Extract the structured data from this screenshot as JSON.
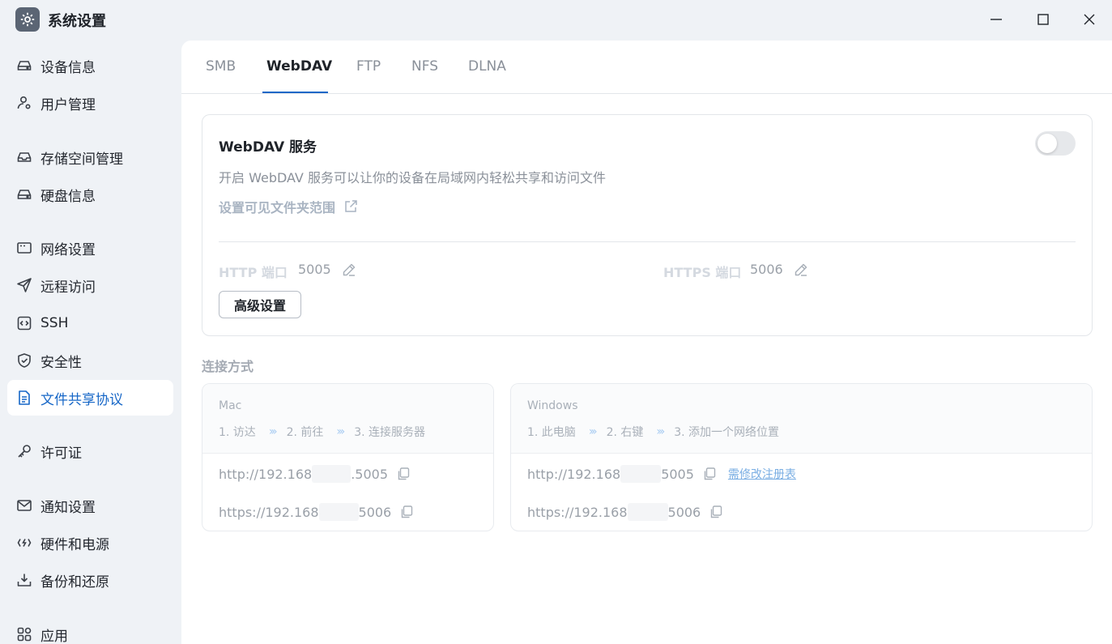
{
  "window": {
    "title": "系统设置",
    "controls": [
      "minimize",
      "maximize",
      "close"
    ]
  },
  "sidebar": {
    "items": [
      {
        "label": "设备信息",
        "icon": "drive-icon"
      },
      {
        "label": "用户管理",
        "icon": "user-gear-icon"
      },
      {
        "label": "存储空间管理",
        "icon": "storage-icon"
      },
      {
        "label": "硬盘信息",
        "icon": "disk-icon"
      },
      {
        "label": "网络设置",
        "icon": "network-icon"
      },
      {
        "label": "远程访问",
        "icon": "send-icon"
      },
      {
        "label": "SSH",
        "icon": "code-icon"
      },
      {
        "label": "安全性",
        "icon": "shield-icon"
      },
      {
        "label": "文件共享协议",
        "icon": "document-icon",
        "active": true
      },
      {
        "label": "许可证",
        "icon": "key-icon"
      },
      {
        "label": "通知设置",
        "icon": "mail-icon"
      },
      {
        "label": "硬件和电源",
        "icon": "power-icon"
      },
      {
        "label": "备份和还原",
        "icon": "download-tray-icon"
      },
      {
        "label": "应用",
        "icon": "grid-icon"
      }
    ]
  },
  "tabs": {
    "items": [
      "SMB",
      "WebDAV",
      "FTP",
      "NFS",
      "DLNA"
    ],
    "active": "WebDAV"
  },
  "service": {
    "title": "WebDAV 服务",
    "description": "开启 WebDAV 服务可以让你的设备在局域网内轻松共享和访问文件",
    "folder_link": "设置可见文件夹范围",
    "enabled": false,
    "http_label": "HTTP 端口",
    "http_port": "5005",
    "https_label": "HTTPS 端口",
    "https_port": "5006",
    "advanced_button": "高级设置"
  },
  "connection": {
    "title": "连接方式",
    "mac": {
      "os": "Mac",
      "steps": [
        "1. 访达",
        "2. 前往",
        "3. 连接服务器"
      ],
      "http_prefix": "http://192.168",
      "http_suffix": ".5005",
      "https_prefix": "https://192.168",
      "https_suffix": "5006"
    },
    "windows": {
      "os": "Windows",
      "steps": [
        "1. 此电脑",
        "2. 右键",
        "3. 添加一个网络位置"
      ],
      "http_prefix": "http://192.168",
      "http_suffix": "5005",
      "https_prefix": "https://192.168",
      "https_suffix": "5006",
      "registry_link": "需修改注册表"
    }
  },
  "colors": {
    "accent": "#1767c7",
    "sidebar_bg": "#eff2f6",
    "step_chevron": "#a8ccf2"
  }
}
